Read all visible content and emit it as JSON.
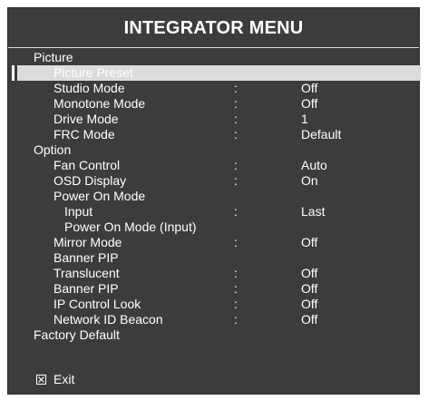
{
  "menu": {
    "title": "INTEGRATOR MENU",
    "colon": ":",
    "items": [
      {
        "label": "Picture",
        "value": ""
      },
      {
        "label": "Picture Preset",
        "value": ""
      },
      {
        "label": "Studio Mode",
        "value": "Off"
      },
      {
        "label": "Monotone Mode",
        "value": "Off"
      },
      {
        "label": "Drive Mode",
        "value": "1"
      },
      {
        "label": "FRC Mode",
        "value": "Default"
      },
      {
        "label": "Option",
        "value": ""
      },
      {
        "label": "Fan Control",
        "value": "Auto"
      },
      {
        "label": "OSD Display",
        "value": "On"
      },
      {
        "label": "Power On Mode",
        "value": ""
      },
      {
        "label": "Input",
        "value": "Last"
      },
      {
        "label": "Power On Mode (Input)",
        "value": ""
      },
      {
        "label": "Mirror Mode",
        "value": "Off"
      },
      {
        "label": "Banner PIP",
        "value": ""
      },
      {
        "label": "Translucent",
        "value": "Off"
      },
      {
        "label": "Banner PIP",
        "value": "Off"
      },
      {
        "label": "IP Control Look",
        "value": "Off"
      },
      {
        "label": "Network ID Beacon",
        "value": "Off"
      },
      {
        "label": "Factory Default",
        "value": ""
      }
    ],
    "exit_label": "Exit",
    "exit_icon": "close-box-icon"
  }
}
